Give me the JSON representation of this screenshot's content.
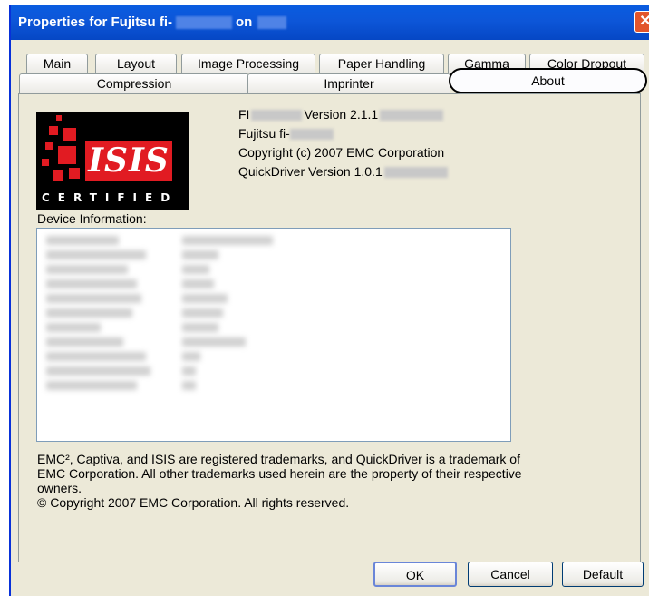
{
  "window": {
    "title_prefix": "Properties for Fujitsu fi-",
    "title_on": "on",
    "close_icon": "close-icon"
  },
  "tabs_row1": [
    "Main",
    "Layout",
    "Image Processing",
    "Paper Handling",
    "Gamma",
    "Color Dropout"
  ],
  "tabs_row2": [
    "Compression",
    "Imprinter",
    "About"
  ],
  "active_tab": "About",
  "logo": {
    "isis": "ISIS",
    "certified": "CERTIFIED"
  },
  "about": {
    "line1_prefix": "FI",
    "line1_version": "Version 2.1.1",
    "line2": "Fujitsu fi-",
    "line3": "Copyright (c) 2007 EMC Corporation",
    "line4": "QuickDriver Version 1.0.1"
  },
  "device_info_label": "Device Information:",
  "footer": {
    "line1": "EMC², Captiva, and ISIS are registered trademarks, and QuickDriver is a trademark of",
    "line2": "EMC Corporation.  All other trademarks used herein are the property of their respective",
    "line3": "owners.",
    "line4": "© Copyright 2007 EMC Corporation.  All rights reserved."
  },
  "buttons": {
    "ok": "OK",
    "cancel": "Cancel",
    "default": "Default"
  },
  "colors": {
    "titlebar": "#0a5ce0",
    "dialog_bg": "#ece9d8",
    "isis_red": "#e11b22"
  }
}
